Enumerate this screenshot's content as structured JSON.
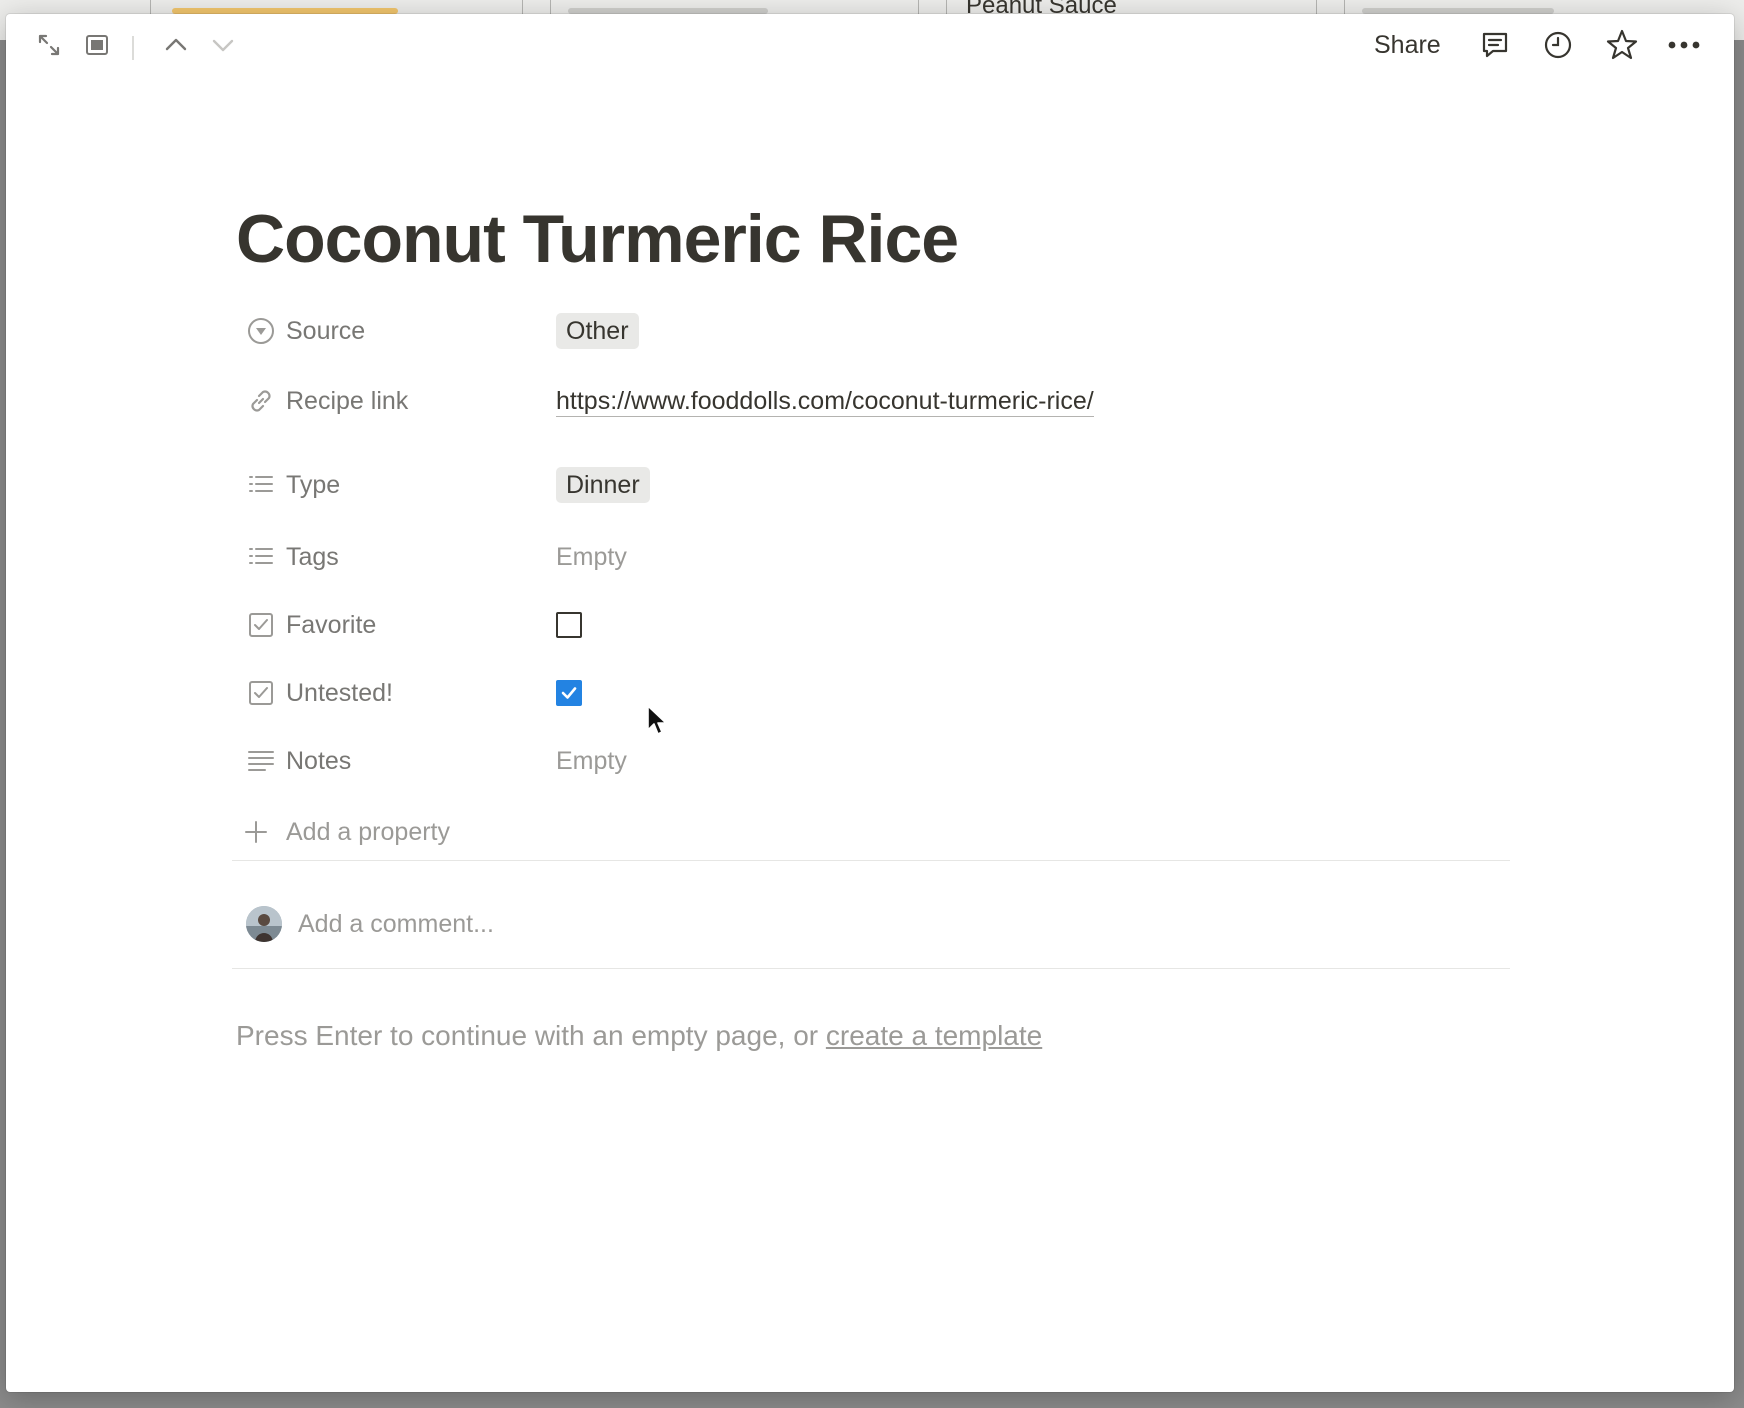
{
  "background": {
    "card_title": "Peanut Sauce"
  },
  "toolbar": {
    "share_label": "Share",
    "icons": [
      "expand-icon",
      "side-peek-icon",
      "chevron-up-icon",
      "chevron-down-icon",
      "comment-icon",
      "history-icon",
      "star-icon",
      "more-icon"
    ]
  },
  "page": {
    "title": "Coconut Turmeric Rice"
  },
  "properties": [
    {
      "name": "Source",
      "icon": "select-icon",
      "type": "tag",
      "value": "Other"
    },
    {
      "name": "Recipe link",
      "icon": "link-icon",
      "type": "url",
      "value": "https://www.fooddolls.com/coconut-turmeric-rice/"
    },
    {
      "name": "Type",
      "icon": "multi-select-icon",
      "type": "tag",
      "value": "Dinner"
    },
    {
      "name": "Tags",
      "icon": "multi-select-icon",
      "type": "empty",
      "value": "Empty"
    },
    {
      "name": "Favorite",
      "icon": "checkbox-icon",
      "type": "checkbox",
      "checked": false
    },
    {
      "name": "Untested!",
      "icon": "checkbox-icon",
      "type": "checkbox",
      "checked": true
    },
    {
      "name": "Notes",
      "icon": "text-icon",
      "type": "empty",
      "value": "Empty"
    }
  ],
  "add_property_label": "Add a property",
  "comment": {
    "placeholder": "Add a comment..."
  },
  "hint": {
    "text": "Press Enter to continue with an empty page, or ",
    "link": "create a template"
  },
  "colors": {
    "text": "#37352f",
    "muted": "#787774",
    "placeholder": "#9b9a97",
    "checkbox_checked": "#2383e2",
    "tag_bg": "#e9e9e7"
  }
}
